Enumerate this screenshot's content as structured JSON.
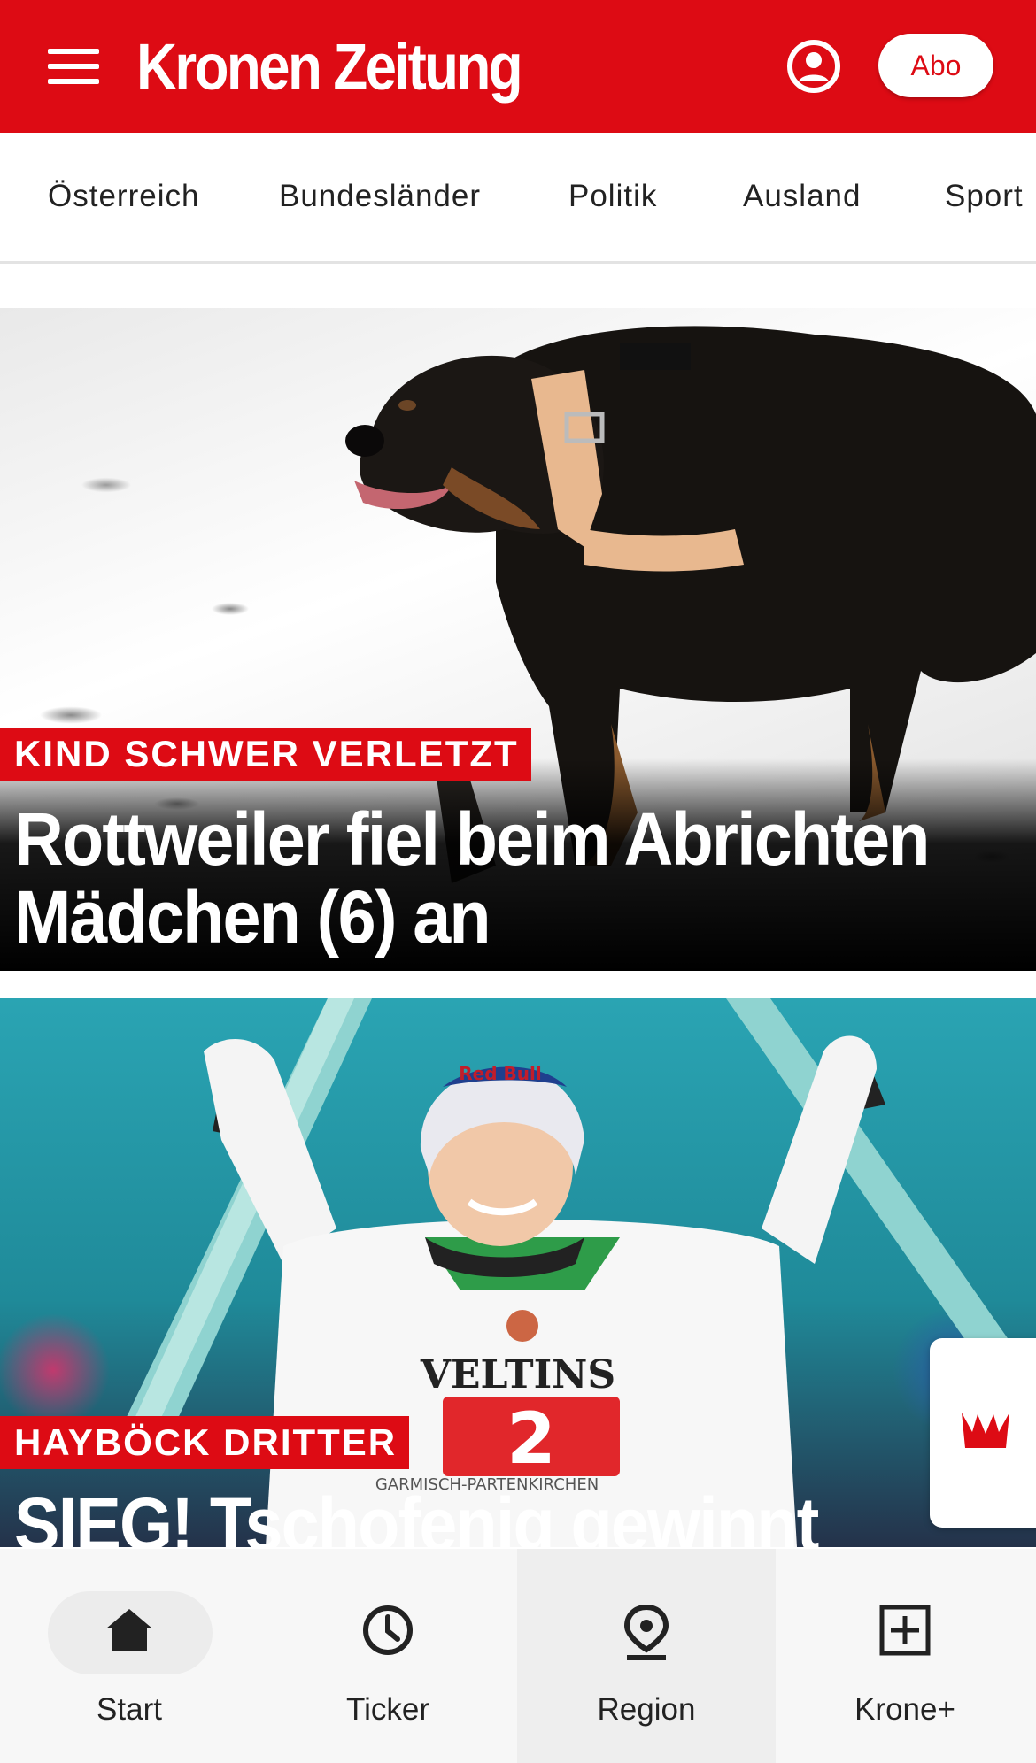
{
  "header": {
    "logo": "Kronen Zeitung",
    "menu_icon": "hamburger-menu-icon",
    "account_icon": "user-account-icon",
    "abo_label": "Abo",
    "brand_color": "#dd0b14"
  },
  "categories": [
    "Österreich",
    "Bundesländer",
    "Politik",
    "Ausland",
    "Sport"
  ],
  "articles": [
    {
      "kicker": "KIND SCHWER VERLETZT",
      "headline": "Rottweiler fiel beim Abrichten Mädchen (6) an",
      "image_icon": "rottweiler-photo"
    },
    {
      "kicker": "HAYBÖCK DRITTER",
      "headline": "SIEG! Tschofenig gewinnt",
      "image_icon": "ski-jumper-photo",
      "image_text": {
        "helmet": "Red Bull",
        "bib_sponsor": "VELTINS",
        "bib_number": "2",
        "location": "GARMISCH-PARTENKIRCHEN"
      }
    }
  ],
  "floating": {
    "icon": "krone-crown-icon"
  },
  "tabbar": {
    "items": [
      {
        "label": "Start",
        "icon": "home-icon",
        "active": true
      },
      {
        "label": "Ticker",
        "icon": "clock-icon",
        "active": false
      },
      {
        "label": "Region",
        "icon": "location-pin-icon",
        "active": false
      },
      {
        "label": "Krone+",
        "icon": "plus-box-icon",
        "active": false
      }
    ]
  }
}
